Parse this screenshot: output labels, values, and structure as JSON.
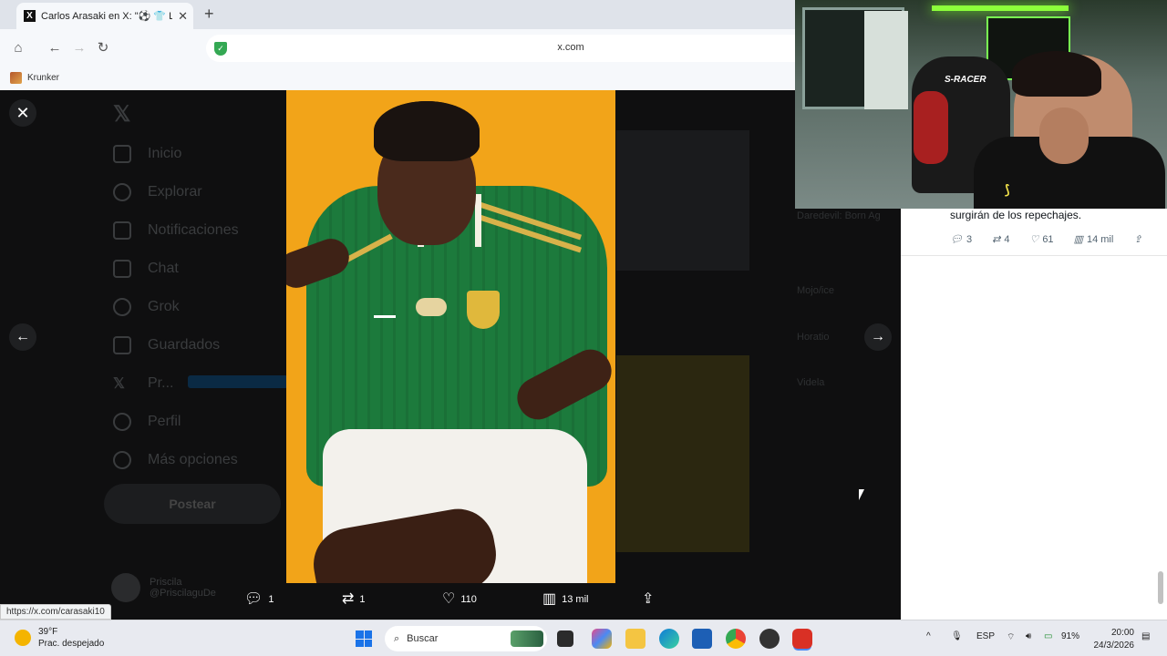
{
  "browser": {
    "tab_title": "Carlos Arasaki en X: \"⚽ 👕 La",
    "url": "x.com",
    "bookmark": "Krunker",
    "status_link": "https://x.com/carasaki10"
  },
  "sidebar": {
    "items": [
      {
        "label": "Inicio"
      },
      {
        "label": "Explorar"
      },
      {
        "label": "Notificaciones"
      },
      {
        "label": "Chat"
      },
      {
        "label": "Grok"
      },
      {
        "label": "Guardados"
      },
      {
        "label": "Pr..."
      },
      {
        "label": "Perfil"
      },
      {
        "label": "Más opciones"
      }
    ],
    "post_button": "Postear",
    "profile_name": "Priscila",
    "profile_handle": "@PriscilaguDe"
  },
  "behind": {
    "lines": [
      "Daredevil: Born Ag",
      "Mojo/ice",
      "Horatio",
      "Videla"
    ]
  },
  "media_actions": {
    "replies": "1",
    "reposts": "1",
    "likes": "110",
    "views": "13 mil"
  },
  "right_panel": {
    "text": "surgirán de los repechajes.",
    "replies": "3",
    "reposts": "4",
    "likes": "61",
    "views": "14 mil"
  },
  "webcam": {
    "chair_label": "S-RACER"
  },
  "taskbar": {
    "temperature": "39°F",
    "weather": "Prac. despejado",
    "search_placeholder": "Buscar",
    "lang": "ESP",
    "battery": "91%",
    "time": "20:00",
    "date": "24/3/2026"
  },
  "colors": {
    "accent": "#1d9bf0",
    "media_bg": "#f2a419",
    "jersey": "#1c7a3c"
  }
}
